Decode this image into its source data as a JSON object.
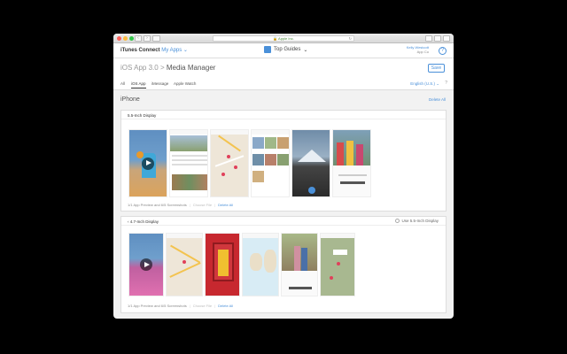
{
  "browser": {
    "url": "Apple Inc."
  },
  "header": {
    "brand": "iTunes Connect",
    "my_apps": "My Apps",
    "top_guides": "Top Guides",
    "user_name": "Kelly Westcott",
    "user_sub": "App Co",
    "help": "?"
  },
  "title": {
    "app_name": "iOS App 3.0",
    "separator": ">",
    "page_name": "Media Manager",
    "save_label": "Save"
  },
  "tabs": [
    {
      "label": "All",
      "active": false
    },
    {
      "label": "iOS App",
      "active": true
    },
    {
      "label": "iMessage",
      "active": false
    },
    {
      "label": "Apple Watch",
      "active": false
    }
  ],
  "language": "English (U.S.)",
  "section": {
    "device": "iPhone",
    "delete_all": "Delete All"
  },
  "displays": [
    {
      "title": "5.5-Inch Display",
      "footer_count": "1/1 App Preview and 6/5 Screenshots",
      "choose": "Choose File",
      "delete_all": "Delete All"
    },
    {
      "title": "4.7-Inch Display",
      "use_label": "Use 5.5-Inch Display",
      "footer_count": "1/1 App Preview and 6/5 Screenshots",
      "choose": "Choose File",
      "delete_all": "Delete All"
    }
  ],
  "colors": {
    "accent": "#4a90d9",
    "light_red": "#fc605b",
    "light_yellow": "#fdbc40",
    "light_green": "#34c84a"
  }
}
